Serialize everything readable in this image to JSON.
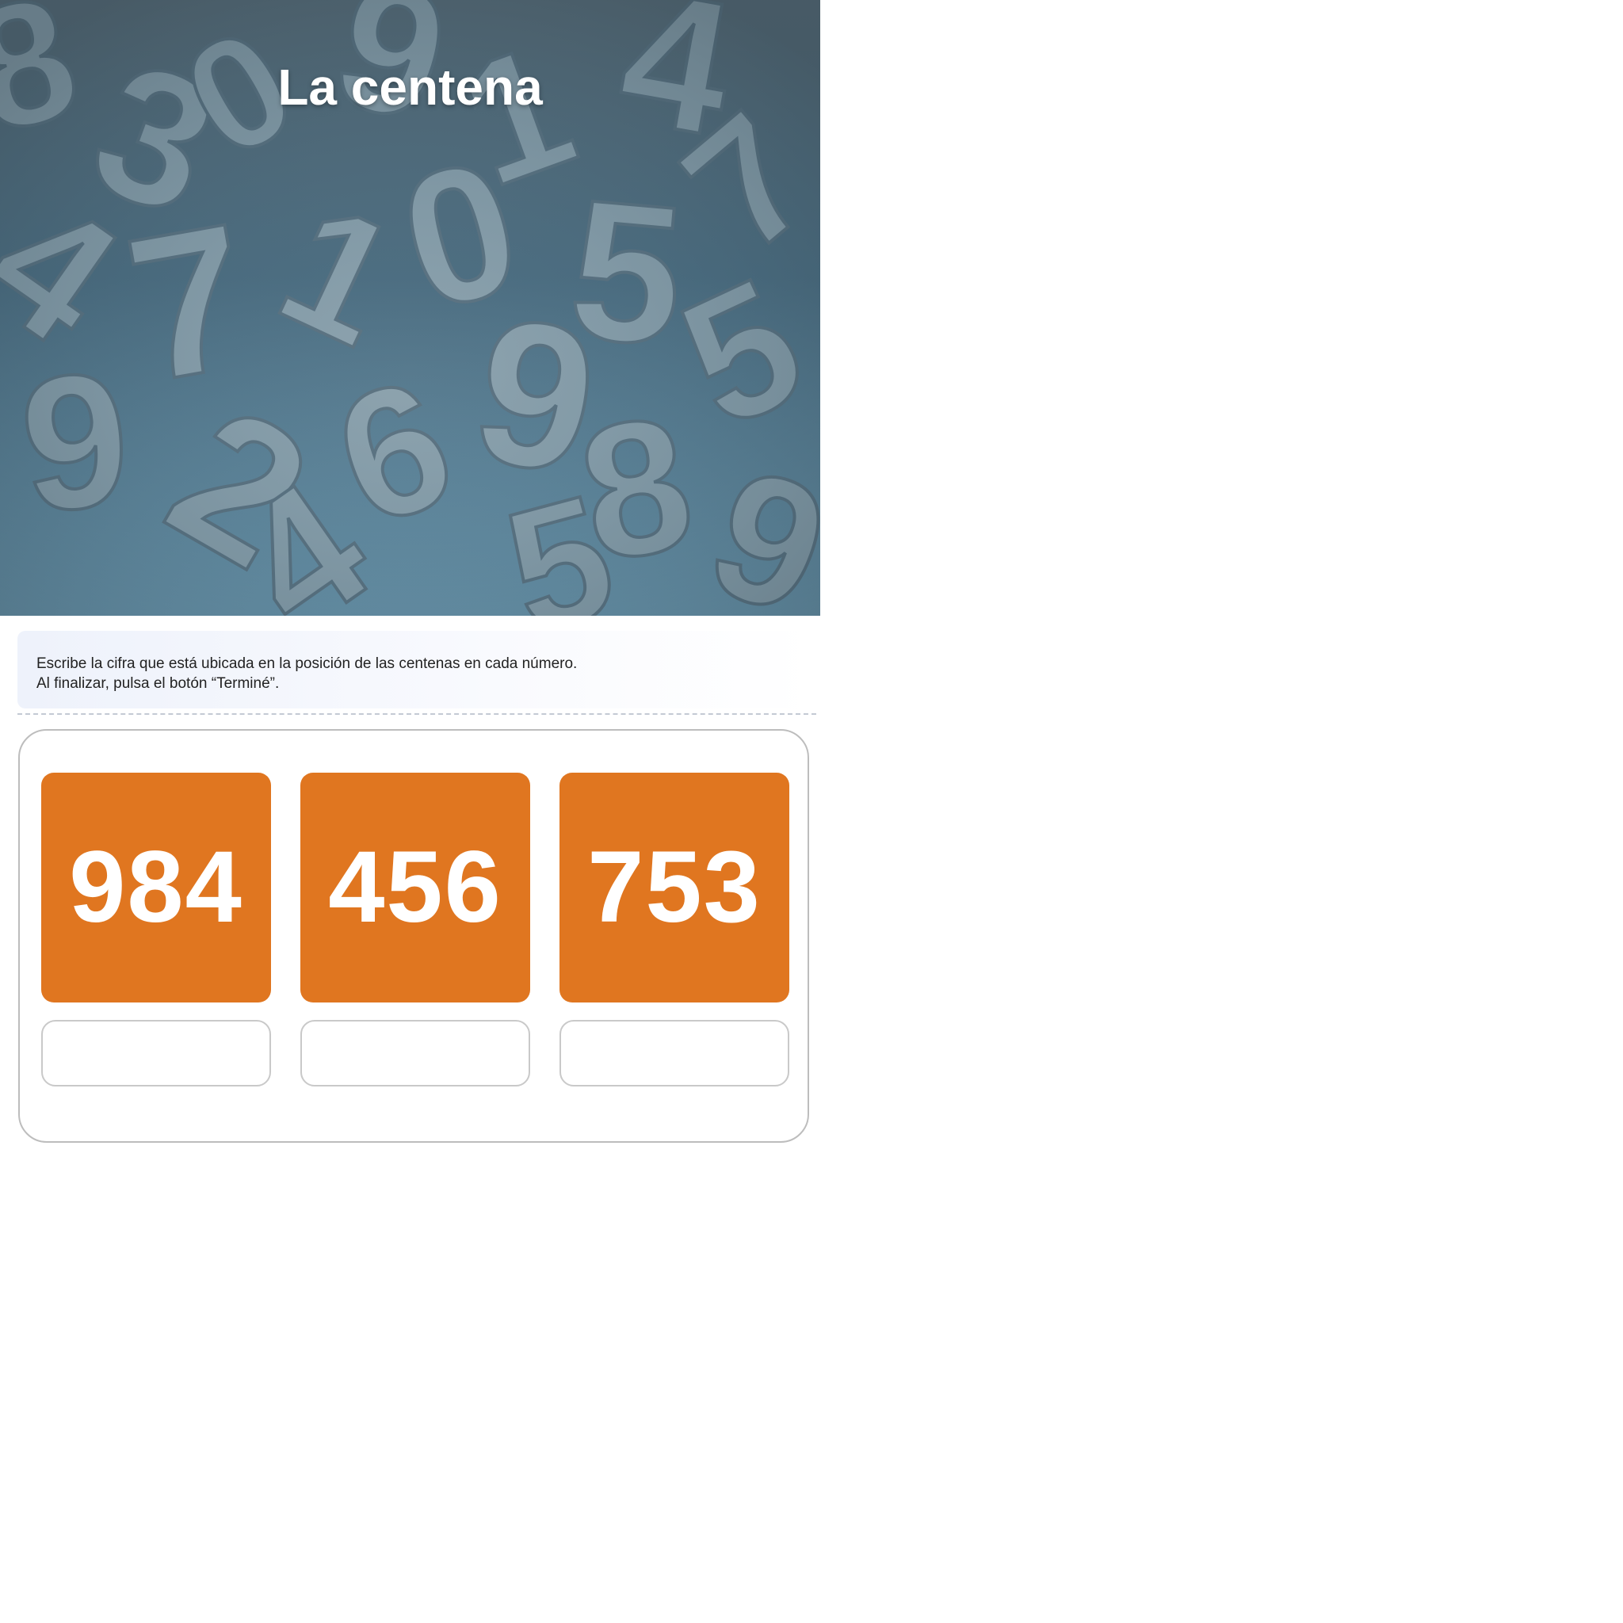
{
  "header": {
    "title": "La centena",
    "background": "scattered-3d-numbers-image"
  },
  "instructions": {
    "line1": "Escribe la cifra que está ubicada en la posición de las centenas en cada número.",
    "line2": "Al finalizar, pulsa el botón “Terminé”."
  },
  "exercise": {
    "items": [
      {
        "number": "984",
        "answer": ""
      },
      {
        "number": "456",
        "answer": ""
      },
      {
        "number": "753",
        "answer": ""
      }
    ]
  },
  "colors": {
    "tile": "#e07620",
    "tile_text": "#ffffff",
    "border": "#bdbdbd",
    "instruction_bg": "#eef2fb"
  }
}
